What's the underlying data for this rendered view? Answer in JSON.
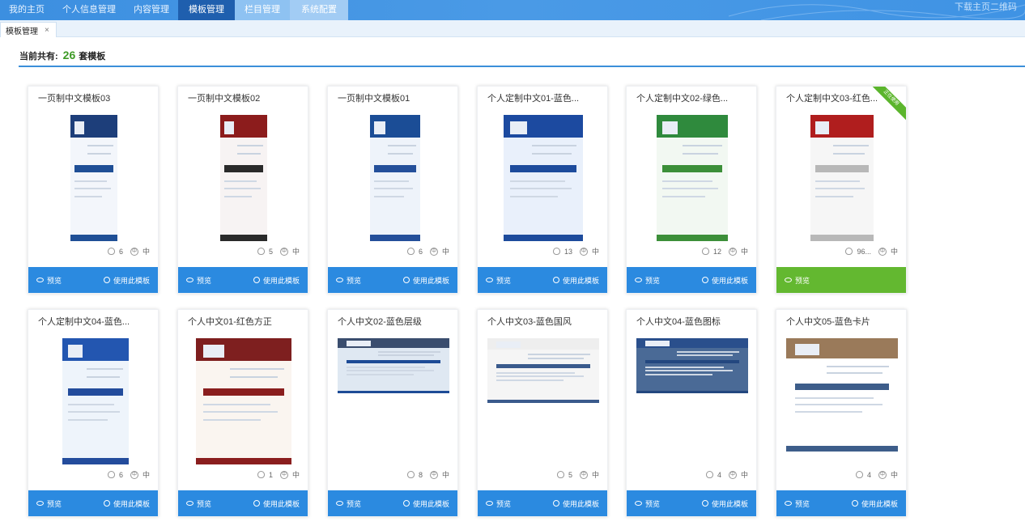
{
  "nav": {
    "items": [
      "我的主页",
      "个人信息管理",
      "内容管理",
      "模板管理",
      "栏目管理",
      "系统配置"
    ],
    "qr_link": "下载主页二维码"
  },
  "tab": {
    "label": "模板管理",
    "close": "×"
  },
  "summary": {
    "prefix": "当前共有:",
    "count": "26",
    "suffix": "套模板"
  },
  "actions": {
    "preview": "预览",
    "use": "使用此模板"
  },
  "ribbon": "正在使用",
  "templates": [
    {
      "title": "一页制中文模板03",
      "uses": "6",
      "lang": "中"
    },
    {
      "title": "一页制中文模板02",
      "uses": "5",
      "lang": "中"
    },
    {
      "title": "一页制中文模板01",
      "uses": "6",
      "lang": "中"
    },
    {
      "title": "个人定制中文01-蓝色...",
      "uses": "13",
      "lang": "中"
    },
    {
      "title": "个人定制中文02-绿色...",
      "uses": "12",
      "lang": "中"
    },
    {
      "title": "个人定制中文03-红色...",
      "uses": "96...",
      "lang": "中",
      "in_use": true
    },
    {
      "title": "个人定制中文04-蓝色...",
      "uses": "6",
      "lang": "中"
    },
    {
      "title": "个人中文01-红色方正",
      "uses": "1",
      "lang": "中"
    },
    {
      "title": "个人中文02-蓝色层级",
      "uses": "8",
      "lang": "中"
    },
    {
      "title": "个人中文03-蓝色国风",
      "uses": "5",
      "lang": "中"
    },
    {
      "title": "个人中文04-蓝色图标",
      "uses": "4",
      "lang": "中"
    },
    {
      "title": "个人中文05-蓝色卡片",
      "uses": "4",
      "lang": "中"
    }
  ],
  "colors": {
    "nav_bg": "#3c8fe0",
    "nav_active": "#1f5fae",
    "action_blue": "#2b8ae0",
    "action_green": "#63b830",
    "count_green": "#3d9a25"
  }
}
